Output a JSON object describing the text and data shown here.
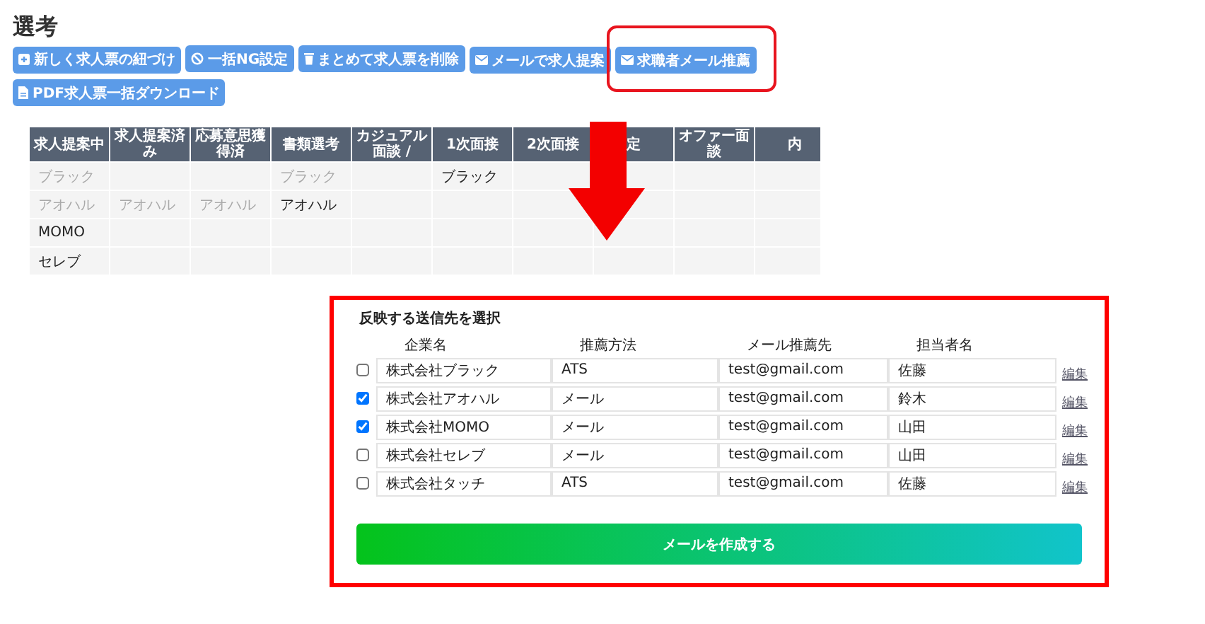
{
  "page": {
    "title": "選考"
  },
  "actions": [
    {
      "label": "新しく求人票の紐づけ",
      "kind": "add",
      "highlighted": false
    },
    {
      "label": "一括NG設定",
      "kind": "block",
      "highlighted": false
    },
    {
      "label": "まとめて求人票を削除",
      "kind": "delete",
      "highlighted": false
    },
    {
      "label": "メールで求人提案",
      "kind": "mail",
      "highlighted": false
    },
    {
      "label": "求職者メール推薦",
      "kind": "mail",
      "highlighted": true
    },
    {
      "label": "PDF求人票一括ダウンロード",
      "kind": "download",
      "highlighted": false
    }
  ],
  "stage_table": {
    "columns": [
      "求人提案中",
      "求人提案済み",
      "応募意思獲得済",
      "書類選考",
      "カジュアル面談 /",
      "1次面接",
      "2次面接",
      "定",
      "オファー面談",
      "内"
    ],
    "rows": [
      {
        "cells": [
          {
            "text": "ブラック",
            "faded": true
          },
          null,
          null,
          {
            "text": "ブラック",
            "faded": true
          },
          null,
          {
            "text": "ブラック",
            "faded": false
          },
          null,
          null,
          null,
          null
        ]
      },
      {
        "cells": [
          {
            "text": "アオハル",
            "faded": true
          },
          {
            "text": "アオハル",
            "faded": true
          },
          {
            "text": "アオハル",
            "faded": true
          },
          {
            "text": "アオハル",
            "faded": false
          },
          null,
          null,
          null,
          null,
          null,
          null
        ]
      },
      {
        "cells": [
          {
            "text": "MOMO",
            "faded": false
          },
          null,
          null,
          null,
          null,
          null,
          null,
          null,
          null,
          null
        ]
      },
      {
        "cells": [
          {
            "text": "セレブ",
            "faded": false
          },
          null,
          null,
          null,
          null,
          null,
          null,
          null,
          null,
          null
        ]
      }
    ]
  },
  "recipient_panel": {
    "title": "反映する送信先を選択",
    "columns": [
      "企業名",
      "推薦方法",
      "メール推薦先",
      "担当者名"
    ],
    "rows": [
      {
        "checked": false,
        "company": "株式会社ブラック",
        "method": "ATS",
        "email": "test@gmail.com",
        "contact": "佐藤",
        "edit": "編集"
      },
      {
        "checked": true,
        "company": "株式会社アオハル",
        "method": "メール",
        "email": "test@gmail.com",
        "contact": "鈴木",
        "edit": "編集"
      },
      {
        "checked": true,
        "company": "株式会社MOMO",
        "method": "メール",
        "email": "test@gmail.com",
        "contact": "山田",
        "edit": "編集"
      },
      {
        "checked": false,
        "company": "株式会社セレブ",
        "method": "メール",
        "email": "test@gmail.com",
        "contact": "山田",
        "edit": "編集"
      },
      {
        "checked": false,
        "company": "株式会社タッチ",
        "method": "ATS",
        "email": "test@gmail.com",
        "contact": "佐藤",
        "edit": "編集"
      }
    ],
    "submit": "メールを作成する"
  }
}
